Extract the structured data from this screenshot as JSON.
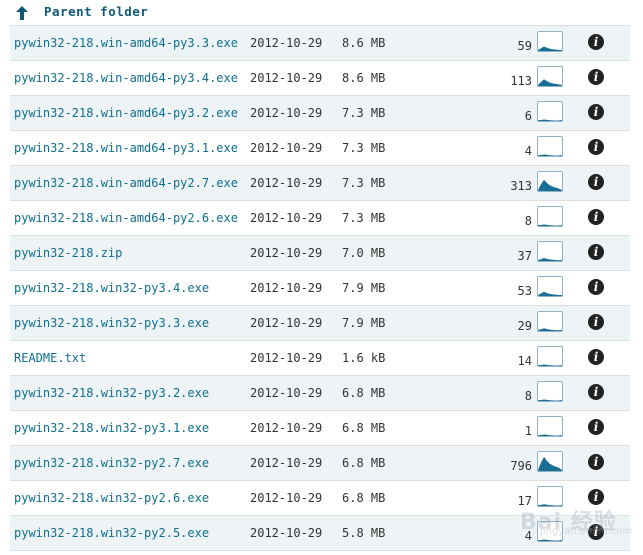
{
  "parent": {
    "label": "Parent folder",
    "icon": "up-arrow-icon"
  },
  "colors": {
    "link": "#0f6f90",
    "row_alt": "#eef4f6",
    "spark_fill": "#1a6e96"
  },
  "files": [
    {
      "name": "pywin32-218.win-amd64-py3.3.exe",
      "date": "2012-10-29",
      "size": "8.6 MB",
      "downloads": "59",
      "activity": 0.3
    },
    {
      "name": "pywin32-218.win-amd64-py3.4.exe",
      "date": "2012-10-29",
      "size": "8.6 MB",
      "downloads": "113",
      "activity": 0.45
    },
    {
      "name": "pywin32-218.win-amd64-py3.2.exe",
      "date": "2012-10-29",
      "size": "7.3 MB",
      "downloads": "6",
      "activity": 0.05
    },
    {
      "name": "pywin32-218.win-amd64-py3.1.exe",
      "date": "2012-10-29",
      "size": "7.3 MB",
      "downloads": "4",
      "activity": 0.04
    },
    {
      "name": "pywin32-218.win-amd64-py2.7.exe",
      "date": "2012-10-29",
      "size": "7.3 MB",
      "downloads": "313",
      "activity": 0.75
    },
    {
      "name": "pywin32-218.win-amd64-py2.6.exe",
      "date": "2012-10-29",
      "size": "7.3 MB",
      "downloads": "8",
      "activity": 0.06
    },
    {
      "name": "pywin32-218.zip",
      "date": "2012-10-29",
      "size": "7.0 MB",
      "downloads": "37",
      "activity": 0.2
    },
    {
      "name": "pywin32-218.win32-py3.4.exe",
      "date": "2012-10-29",
      "size": "7.9 MB",
      "downloads": "53",
      "activity": 0.28
    },
    {
      "name": "pywin32-218.win32-py3.3.exe",
      "date": "2012-10-29",
      "size": "7.9 MB",
      "downloads": "29",
      "activity": 0.18
    },
    {
      "name": "README.txt",
      "date": "2012-10-29",
      "size": "1.6 kB",
      "downloads": "14",
      "activity": 0.1
    },
    {
      "name": "pywin32-218.win32-py3.2.exe",
      "date": "2012-10-29",
      "size": "6.8 MB",
      "downloads": "8",
      "activity": 0.06
    },
    {
      "name": "pywin32-218.win32-py3.1.exe",
      "date": "2012-10-29",
      "size": "6.8 MB",
      "downloads": "1",
      "activity": 0.03
    },
    {
      "name": "pywin32-218.win32-py2.7.exe",
      "date": "2012-10-29",
      "size": "6.8 MB",
      "downloads": "796",
      "activity": 0.95
    },
    {
      "name": "pywin32-218.win32-py2.6.exe",
      "date": "2012-10-29",
      "size": "6.8 MB",
      "downloads": "17",
      "activity": 0.12
    },
    {
      "name": "pywin32-218.win32-py2.5.exe",
      "date": "2012-10-29",
      "size": "5.8 MB",
      "downloads": "4",
      "activity": 0.04
    }
  ],
  "watermark": {
    "text": "Bai 经验",
    "sub": "jingyan.baidu.com"
  }
}
